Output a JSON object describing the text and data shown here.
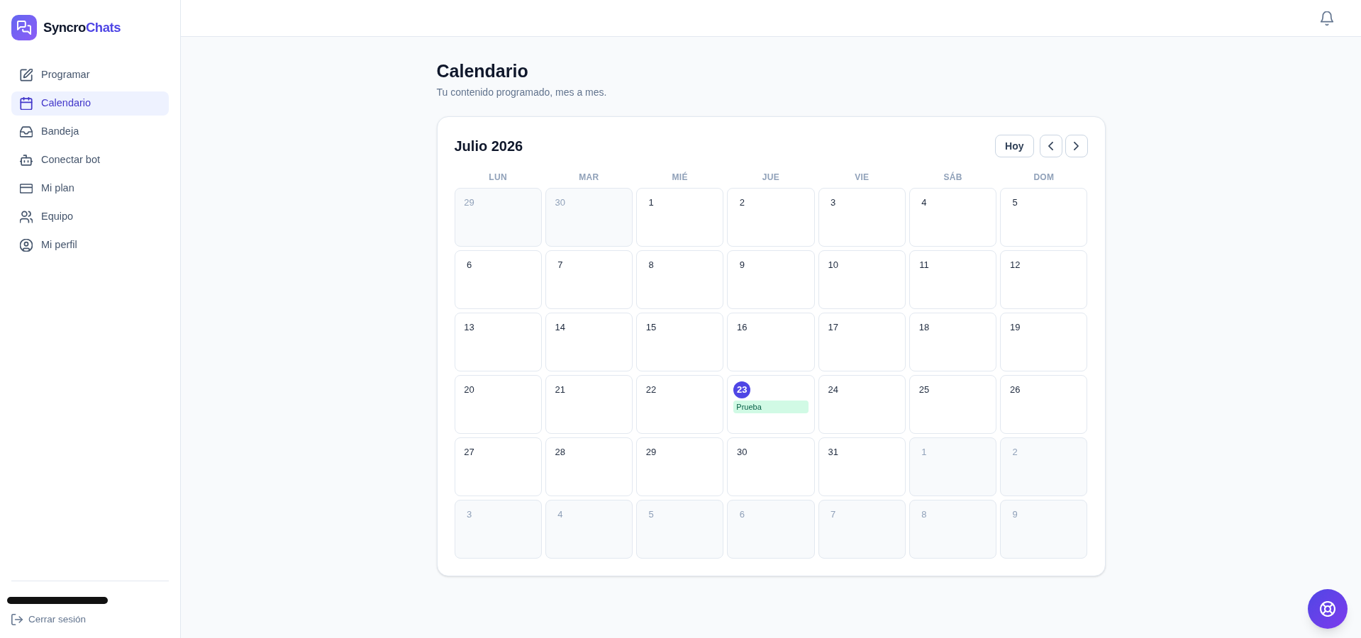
{
  "sidebar": {
    "brand": {
      "name": "Syncro",
      "accent": "Chats"
    },
    "nav": [
      {
        "label": "Programar",
        "selected": false
      },
      {
        "label": "Calendario",
        "selected": true
      },
      {
        "label": "Bandeja",
        "selected": false
      },
      {
        "label": "Conectar bot",
        "selected": false
      },
      {
        "label": "Mi plan",
        "selected": false
      },
      {
        "label": "Equipo",
        "selected": false
      },
      {
        "label": "Mi perfil",
        "selected": false
      }
    ],
    "logout": "Cerrar sesión"
  },
  "page": {
    "title": "Calendario",
    "subtitle": "Tu contenido programado, mes a mes."
  },
  "calendar": {
    "month": "Julio 2026",
    "today_button": "Hoy",
    "weekdays": [
      "LUN",
      "MAR",
      "MIÉ",
      "JUE",
      "VIE",
      "SÁB",
      "DOM"
    ],
    "days": [
      {
        "day": "29",
        "in_month": false,
        "today": false
      },
      {
        "day": "30",
        "in_month": false,
        "today": false
      },
      {
        "day": "1",
        "in_month": true,
        "today": false
      },
      {
        "day": "2",
        "in_month": true,
        "today": false
      },
      {
        "day": "3",
        "in_month": true,
        "today": false
      },
      {
        "day": "4",
        "in_month": true,
        "today": false
      },
      {
        "day": "5",
        "in_month": true,
        "today": false
      },
      {
        "day": "6",
        "in_month": true,
        "today": false
      },
      {
        "day": "7",
        "in_month": true,
        "today": false
      },
      {
        "day": "8",
        "in_month": true,
        "today": false
      },
      {
        "day": "9",
        "in_month": true,
        "today": false
      },
      {
        "day": "10",
        "in_month": true,
        "today": false
      },
      {
        "day": "11",
        "in_month": true,
        "today": false
      },
      {
        "day": "12",
        "in_month": true,
        "today": false
      },
      {
        "day": "13",
        "in_month": true,
        "today": false
      },
      {
        "day": "14",
        "in_month": true,
        "today": false
      },
      {
        "day": "15",
        "in_month": true,
        "today": false
      },
      {
        "day": "16",
        "in_month": true,
        "today": false
      },
      {
        "day": "17",
        "in_month": true,
        "today": false
      },
      {
        "day": "18",
        "in_month": true,
        "today": false
      },
      {
        "day": "19",
        "in_month": true,
        "today": false
      },
      {
        "day": "20",
        "in_month": true,
        "today": false
      },
      {
        "day": "21",
        "in_month": true,
        "today": false
      },
      {
        "day": "22",
        "in_month": true,
        "today": false
      },
      {
        "day": "23",
        "in_month": true,
        "today": true,
        "events": [
          {
            "title": "Prueba"
          }
        ]
      },
      {
        "day": "24",
        "in_month": true,
        "today": false
      },
      {
        "day": "25",
        "in_month": true,
        "today": false
      },
      {
        "day": "26",
        "in_month": true,
        "today": false
      },
      {
        "day": "27",
        "in_month": true,
        "today": false
      },
      {
        "day": "28",
        "in_month": true,
        "today": false
      },
      {
        "day": "29",
        "in_month": true,
        "today": false
      },
      {
        "day": "30",
        "in_month": true,
        "today": false
      },
      {
        "day": "31",
        "in_month": true,
        "today": false
      },
      {
        "day": "1",
        "in_month": false,
        "today": false
      },
      {
        "day": "2",
        "in_month": false,
        "today": false
      },
      {
        "day": "3",
        "in_month": false,
        "today": false
      },
      {
        "day": "4",
        "in_month": false,
        "today": false
      },
      {
        "day": "5",
        "in_month": false,
        "today": false
      },
      {
        "day": "6",
        "in_month": false,
        "today": false
      },
      {
        "day": "7",
        "in_month": false,
        "today": false
      },
      {
        "day": "8",
        "in_month": false,
        "today": false
      },
      {
        "day": "9",
        "in_month": false,
        "today": false
      }
    ]
  }
}
